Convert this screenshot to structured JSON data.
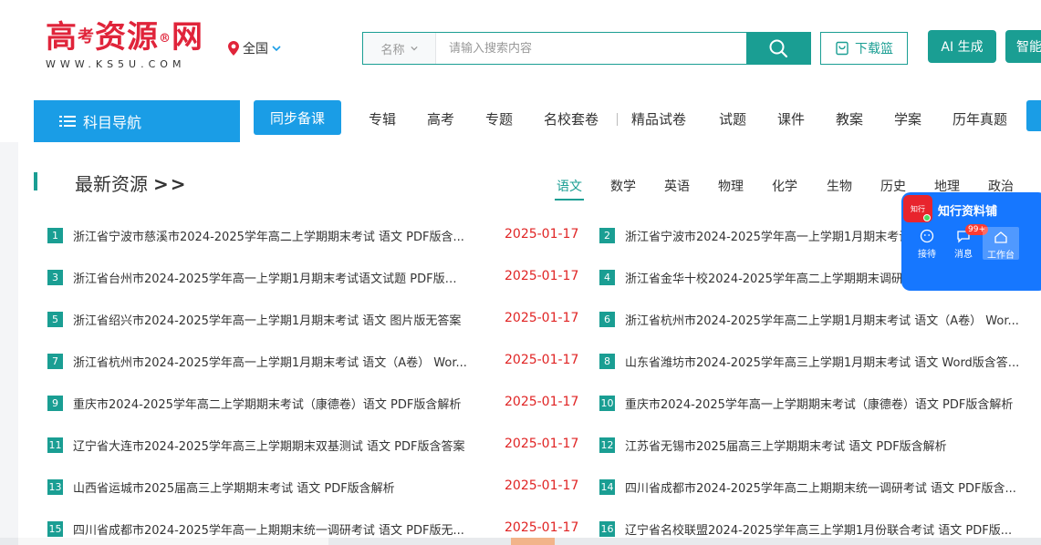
{
  "header": {
    "logo": {
      "main_a": "高",
      "main_b": "考",
      "main_c": "资源",
      "reg": "®",
      "main_d": "网",
      "sub": "WWW.KS5U.COM"
    },
    "region": "全国",
    "search": {
      "category": "名称",
      "placeholder": "请输入搜索内容"
    },
    "download_basket": "下载篮",
    "ai_button": "AI 生成",
    "smart_button": "智能"
  },
  "nav": {
    "subject_nav": "科目导航",
    "sync_prep": "同步备课",
    "items": [
      "专辑",
      "高考",
      "专题",
      "名校套卷",
      "精品试卷",
      "试题",
      "课件",
      "教案",
      "学案",
      "历年真题"
    ]
  },
  "section": {
    "title": "最新资源",
    "arrows": ">>",
    "tabs": [
      "语文",
      "数学",
      "英语",
      "物理",
      "化学",
      "生物",
      "历史",
      "地理",
      "政治"
    ]
  },
  "resources_left": [
    {
      "num": "1",
      "title": "浙江省宁波市慈溪市2024-2025学年高二上学期期末考试 语文 PDF版含...",
      "date": "2025-01-17"
    },
    {
      "num": "3",
      "title": "浙江省台州市2024-2025学年高一上学期1月期末考试语文试题 PDF版含...",
      "date": "2025-01-17"
    },
    {
      "num": "5",
      "title": "浙江省绍兴市2024-2025学年高一上学期1月期末考试 语文 图片版无答案",
      "date": "2025-01-17"
    },
    {
      "num": "7",
      "title": "浙江省杭州市2024-2025学年高一上学期1月期末考试 语文（A卷） Wor...",
      "date": "2025-01-17"
    },
    {
      "num": "9",
      "title": "重庆市2024-2025学年高二上学期期末考试（康德卷）语文 PDF版含解析",
      "date": "2025-01-17"
    },
    {
      "num": "11",
      "title": "辽宁省大连市2024-2025学年高三上学期期末双基测试 语文 PDF版含答案",
      "date": "2025-01-17"
    },
    {
      "num": "13",
      "title": "山西省运城市2025届高三上学期期末考试 语文 PDF版含解析",
      "date": "2025-01-17"
    },
    {
      "num": "15",
      "title": "四川省成都市2024-2025学年高一上期期末统一调研考试 语文 PDF版无...",
      "date": "2025-01-17"
    }
  ],
  "resources_right": [
    {
      "num": "2",
      "title": "浙江省宁波市2024-2025学年高一上学期1月期末考试 语文"
    },
    {
      "num": "4",
      "title": "浙江省金华十校2024-2025学年高二上学期期末调研考试 语文"
    },
    {
      "num": "6",
      "title": "浙江省杭州市2024-2025学年高二上学期1月期末考试 语文（A卷） Wor..."
    },
    {
      "num": "8",
      "title": "山东省潍坊市2024-2025学年高三上学期1月期末考试 语文 Word版含答..."
    },
    {
      "num": "10",
      "title": "重庆市2024-2025学年高一上学期期末考试（康德卷）语文 PDF版含解析"
    },
    {
      "num": "12",
      "title": "江苏省无锡市2025届高三上学期期末考试 语文 PDF版含解析"
    },
    {
      "num": "14",
      "title": "四川省成都市2024-2025学年高二上期期末统一调研考试 语文 PDF版含..."
    },
    {
      "num": "16",
      "title": "辽宁省名校联盟2024-2025学年高三上学期1月份联合考试 语文 PDF版..."
    }
  ],
  "widget": {
    "logo_text": "知行",
    "name": "知行资料铺",
    "items": [
      "接待",
      "消息",
      "工作台"
    ],
    "badge": "99+"
  },
  "colors": {
    "primary_teal": "#1a9e93",
    "nav_blue": "#1a9de6",
    "logo_red": "#e0243a",
    "date_red": "#e02424",
    "widget_blue": "#1677ff"
  }
}
